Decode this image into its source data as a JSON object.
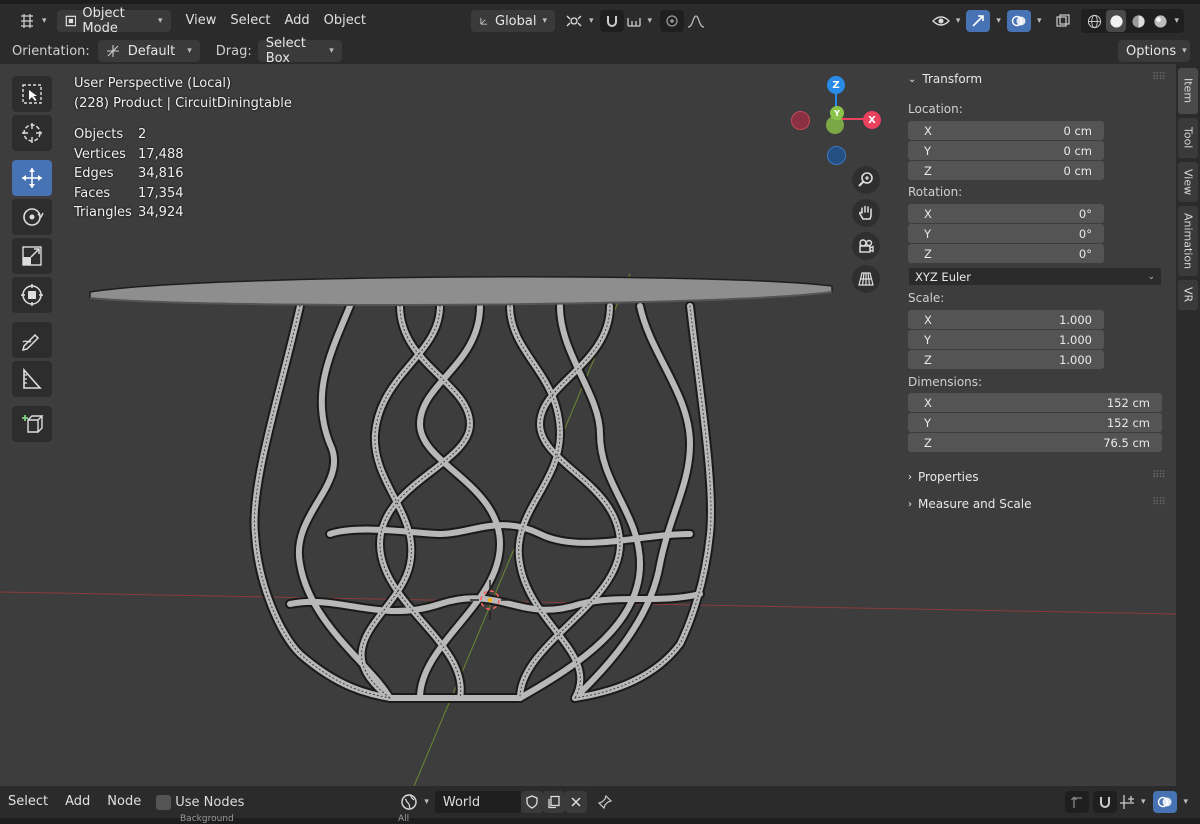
{
  "header": {
    "mode": "Object Mode",
    "menus": [
      "View",
      "Select",
      "Add",
      "Object"
    ],
    "transform_orientation": "Global"
  },
  "toolsettings": {
    "orientation_label": "Orientation:",
    "orientation_value": "Default",
    "drag_label": "Drag:",
    "drag_value": "Select Box",
    "options_label": "Options"
  },
  "viewport": {
    "perspective": "User Perspective (Local)",
    "collection": "(228) Product | CircuitDiningtable",
    "stats": [
      {
        "label": "Objects",
        "value": "2"
      },
      {
        "label": "Vertices",
        "value": "17,488"
      },
      {
        "label": "Edges",
        "value": "34,816"
      },
      {
        "label": "Faces",
        "value": "17,354"
      },
      {
        "label": "Triangles",
        "value": "34,924"
      }
    ],
    "gizmo": {
      "z": "Z",
      "x": "X",
      "y": "Y"
    }
  },
  "npanel": {
    "transform_title": "Transform",
    "location_label": "Location:",
    "location": [
      {
        "axis": "X",
        "value": "0 cm"
      },
      {
        "axis": "Y",
        "value": "0 cm"
      },
      {
        "axis": "Z",
        "value": "0 cm"
      }
    ],
    "rotation_label": "Rotation:",
    "rotation": [
      {
        "axis": "X",
        "value": "0°"
      },
      {
        "axis": "Y",
        "value": "0°"
      },
      {
        "axis": "Z",
        "value": "0°"
      }
    ],
    "rotation_mode": "XYZ Euler",
    "scale_label": "Scale:",
    "scale": [
      {
        "axis": "X",
        "value": "1.000"
      },
      {
        "axis": "Y",
        "value": "1.000"
      },
      {
        "axis": "Z",
        "value": "1.000"
      }
    ],
    "dimensions_label": "Dimensions:",
    "dimensions": [
      {
        "axis": "X",
        "value": "152 cm"
      },
      {
        "axis": "Y",
        "value": "152 cm"
      },
      {
        "axis": "Z",
        "value": "76.5 cm"
      }
    ],
    "properties_title": "Properties",
    "measure_title": "Measure and Scale"
  },
  "tabs": [
    "Item",
    "Tool",
    "View",
    "Animation",
    "VR"
  ],
  "nodebar": {
    "menus": [
      "Select",
      "Add",
      "Node"
    ],
    "use_nodes_label": "Use Nodes",
    "world_name": "World",
    "bottom_left": "Background",
    "bottom_mid": "All"
  },
  "colors": {
    "accent": "#4772b3",
    "axis_x": "#e8425d",
    "axis_y": "#8bc34a",
    "axis_z": "#2a8be6"
  }
}
